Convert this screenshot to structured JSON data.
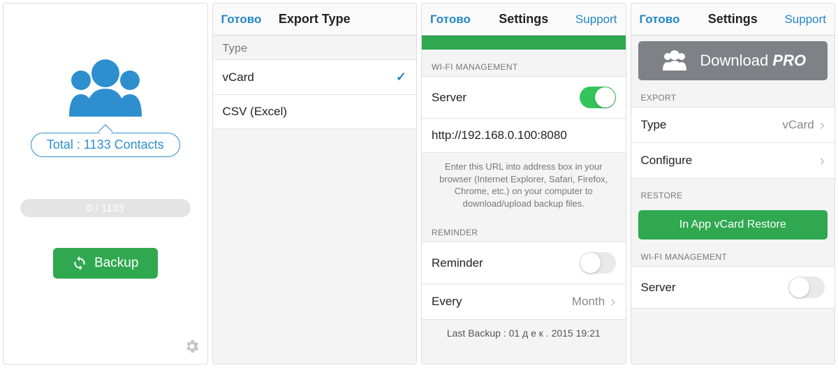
{
  "screen1": {
    "total_label": "Total : 1133 Contacts",
    "progress_text": "0 / 1133",
    "backup_label": "Backup"
  },
  "screen2": {
    "nav_left": "Готово",
    "nav_title": "Export Type",
    "header_type": "Type",
    "opt_vcard": "vCard",
    "opt_csv": "CSV (Excel)"
  },
  "screen3": {
    "nav_left": "Готово",
    "nav_title": "Settings",
    "nav_right": "Support",
    "sec_wifi": "WI-FI MANAGEMENT",
    "row_server": "Server",
    "row_url": "http://192.168.0.100:8080",
    "hint": "Enter this URL into address box in your browser (Internet Explorer, Safari, Firefox, Chrome, etc.) on your computer to download/upload backup files.",
    "sec_reminder": "REMINDER",
    "row_reminder": "Reminder",
    "row_every": "Every",
    "row_every_val": "Month",
    "footer": "Last Backup : 01 д е к . 2015 19:21"
  },
  "screen4": {
    "nav_left": "Готово",
    "nav_title": "Settings",
    "nav_right": "Support",
    "pro_label": "Download",
    "pro_word": "PRO",
    "sec_export": "EXPORT",
    "row_type": "Type",
    "row_type_val": "vCard",
    "row_configure": "Configure",
    "sec_restore": "RESTORE",
    "restore_btn": "In App vCard Restore",
    "sec_wifi": "WI-FI MANAGEMENT",
    "row_server": "Server"
  }
}
